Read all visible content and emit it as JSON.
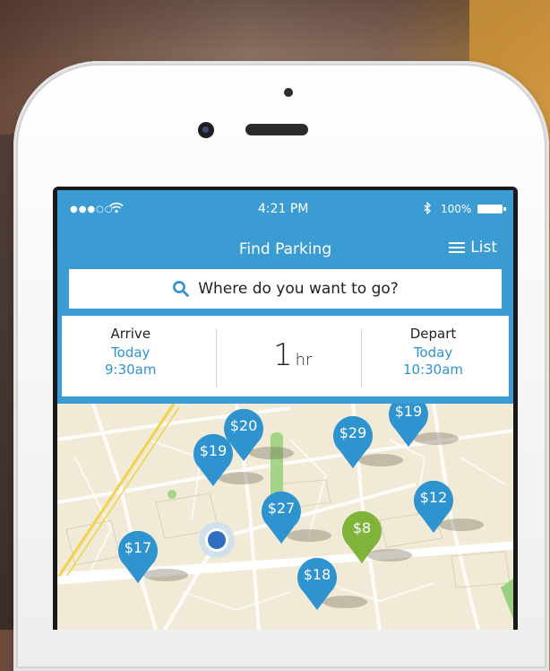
{
  "status_bar": {
    "signal": "●●●○○",
    "time": "4:21 PM",
    "battery": "100%"
  },
  "nav": {
    "title": "Find Parking",
    "list_label": "List"
  },
  "search": {
    "placeholder": "Where do you want to go?"
  },
  "arrive": {
    "label": "Arrive",
    "day": "Today",
    "time": "9:30am"
  },
  "duration": {
    "value": "1",
    "unit": "hr"
  },
  "depart": {
    "label": "Depart",
    "day": "Today",
    "time": "10:30am"
  },
  "pins": [
    {
      "price": "$20",
      "color": "#2e93cf"
    },
    {
      "price": "$19",
      "color": "#2e93cf"
    },
    {
      "price": "$29",
      "color": "#2e93cf"
    },
    {
      "price": "$19",
      "color": "#2e93cf"
    },
    {
      "price": "$27",
      "color": "#2e93cf"
    },
    {
      "price": "$12",
      "color": "#2e93cf"
    },
    {
      "price": "$8",
      "color": "#7fb33a"
    },
    {
      "price": "$17",
      "color": "#2e93cf"
    },
    {
      "price": "$18",
      "color": "#2e93cf"
    }
  ],
  "colors": {
    "brand_blue": "#3b9bd3",
    "accent_blue": "#2e93cf",
    "cheapest_green": "#7fb33a",
    "map_background": "#f0ead6"
  },
  "icons": [
    "wifi-icon",
    "bluetooth-icon",
    "battery-icon",
    "list-icon",
    "search-icon",
    "location-marker-icon"
  ]
}
